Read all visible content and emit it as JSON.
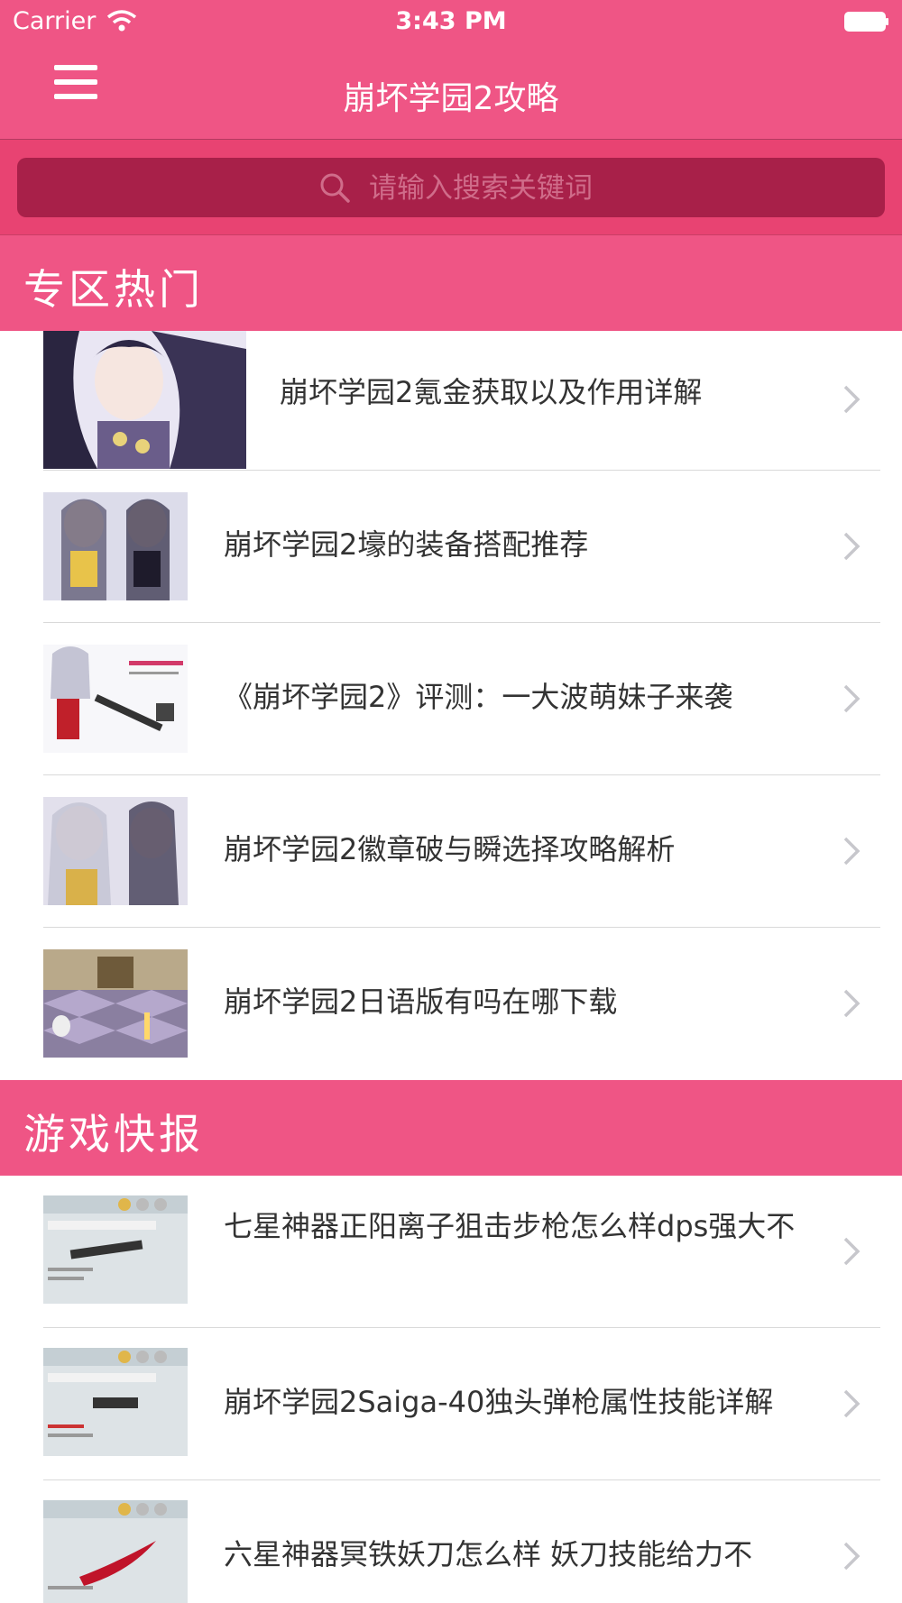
{
  "status_bar": {
    "carrier": "Carrier",
    "time": "3:43 PM"
  },
  "nav": {
    "title": "崩坏学园2攻略",
    "menu_icon": "hamburger-menu-icon"
  },
  "search": {
    "placeholder": "请输入搜索关键词",
    "value": ""
  },
  "colors": {
    "accent": "#ef5585",
    "search_bg": "#a82049",
    "text": "#333333"
  },
  "sections": [
    {
      "title": "专区热门",
      "items": [
        {
          "label": "崩坏学园2氪金获取以及作用详解"
        },
        {
          "label": "崩坏学园2壕的装备搭配推荐"
        },
        {
          "label": "《崩坏学园2》评测：一大波萌妹子来袭"
        },
        {
          "label": "崩坏学园2徽章破与瞬选择攻略解析"
        },
        {
          "label": "崩坏学园2日语版有吗在哪下载"
        }
      ]
    },
    {
      "title": "游戏快报",
      "items": [
        {
          "label": "七星神器正阳离子狙击步枪怎么样dps强大不"
        },
        {
          "label": "崩坏学园2Saiga-40独头弹枪属性技能详解"
        },
        {
          "label": "六星神器冥铁妖刀怎么样 妖刀技能给力不"
        }
      ]
    }
  ]
}
